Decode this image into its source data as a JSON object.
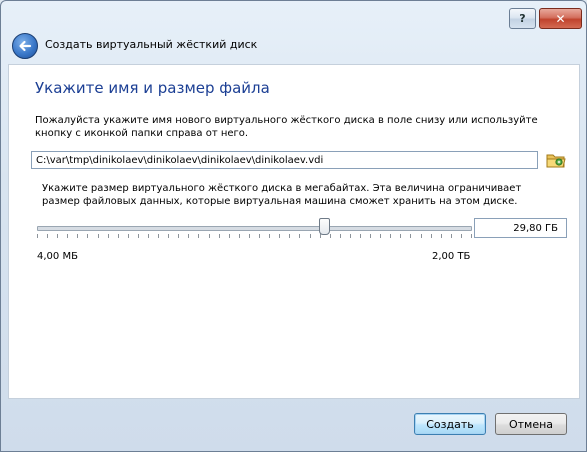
{
  "window": {
    "help_label": "?",
    "close_label": "✕",
    "title": "Создать виртуальный жёсткий диск"
  },
  "page": {
    "heading": "Укажите имя и размер файла",
    "description": "Пожалуйста укажите имя нового виртуального жёсткого диска в поле снизу или используйте кнопку с иконкой папки справа от него.",
    "path_value": "C:\\var\\tmp\\dinikolaev\\dinikolaev\\dinikolaev\\dinikolaev.vdi",
    "size_description": "Укажите размер виртуального жёсткого диска в мегабайтах. Эта величина ограничивает размер файловых данных, которые виртуальная машина сможет хранить на этом диске.",
    "size_value": "29,80 ГБ",
    "slider_min_label": "4,00 МБ",
    "slider_max_label": "2,00 ТБ",
    "slider_level_fraction": 0.66
  },
  "buttons": {
    "create_label": "Создать",
    "cancel_label": "Отмена"
  },
  "icons": {
    "back": "back-arrow-icon",
    "folder": "folder-browse-icon"
  },
  "colors": {
    "heading": "#1c3f94",
    "default_button_border": "#3c7fb1",
    "close_button": "#c0432d"
  }
}
